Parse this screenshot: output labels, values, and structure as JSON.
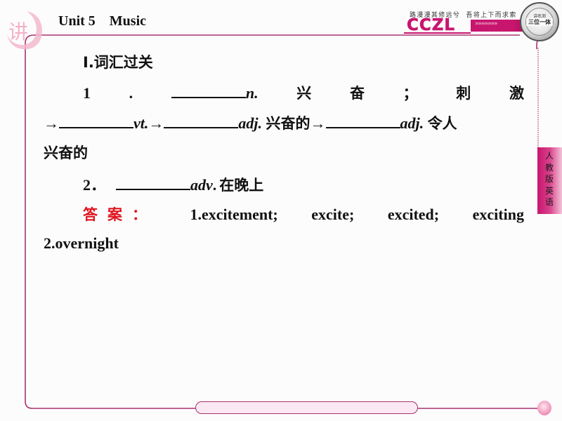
{
  "header": {
    "watermark_glyph": "讲",
    "unit_title": "Unit 5    Music",
    "slogan": "路漫漫其修远兮  吾将上下而求索",
    "logo_text": "CCZL",
    "logo_chevrons": "»»»»»»»",
    "badge": {
      "top_text": "讲练测",
      "main_text": "三位一体"
    }
  },
  "side_tab": {
    "label": "人教版英语"
  },
  "colors": {
    "brand": "#c8156e",
    "frame": "#a8336e",
    "answer_label": "#e0141e"
  },
  "content": {
    "section_title": "Ⅰ.词汇过关",
    "q1": {
      "number": "1",
      "dot": ".",
      "pos1": "n.",
      "meaning_chars": [
        "兴",
        "奋",
        "；",
        "刺",
        "激"
      ],
      "arrow": "→",
      "pos2": "vt.",
      "pos3": "adj.",
      "meaning3": "兴奋的",
      "pos4": "adj.",
      "meaning4_part1": "令人",
      "meaning4_part2": "兴奋的"
    },
    "q2": {
      "number": "2．",
      "pos": "adv",
      "dot": ".",
      "meaning": "在晚上"
    },
    "answer": {
      "label_chars": [
        "答",
        "案",
        "："
      ],
      "items_line1": [
        "1.excitement;",
        "excite;",
        "excited;",
        "exciting"
      ],
      "items_line2": "2.overnight"
    }
  }
}
